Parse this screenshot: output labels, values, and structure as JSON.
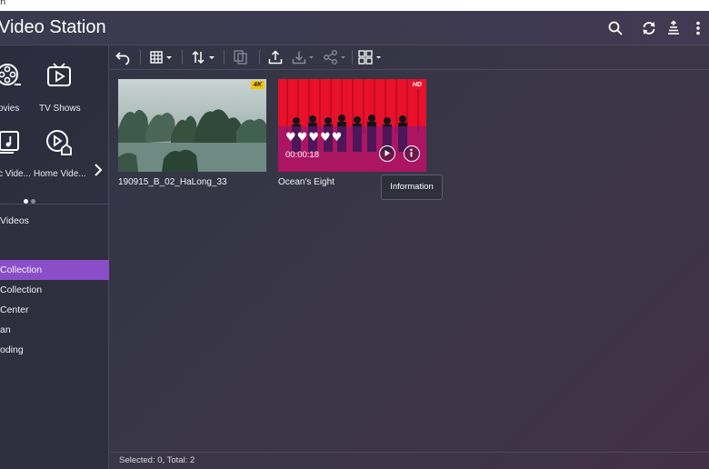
{
  "top_strip": {
    "text": "n"
  },
  "header": {
    "title": "Video Station",
    "icons": [
      "search-icon",
      "refresh-icon",
      "tasks-icon",
      "more-icon"
    ]
  },
  "sidebar": {
    "tiles": [
      {
        "label": "ovies",
        "icon": "film-reel-icon"
      },
      {
        "label": "TV Shows",
        "icon": "tv-icon"
      },
      {
        "label": "c Vide...",
        "icon": "music-video-icon"
      },
      {
        "label": "Home Vide...",
        "icon": "home-video-icon"
      }
    ],
    "section_label": "Videos",
    "nav_items": [
      {
        "label": "Collection",
        "active": true
      },
      {
        "label": "Collection",
        "active": false
      },
      {
        "label": "Center",
        "active": false
      },
      {
        "label": "an",
        "active": false
      },
      {
        "label": "oding",
        "active": false
      }
    ],
    "page_dots": 2,
    "active_page": 1
  },
  "toolbar": {
    "icons": [
      "back-icon",
      "grid-view-icon",
      "sort-icon",
      "copy-icon",
      "upload-icon",
      "download-icon",
      "share-icon",
      "multi-select-icon"
    ]
  },
  "videos": [
    {
      "title": "190915_B_02_HaLong_33",
      "badge": "4K",
      "badge_color": "#f5c400"
    },
    {
      "title": "Ocean's Eight",
      "badge": "HD",
      "badge_color": "#e8102a",
      "rating_hearts": 5,
      "duration": "00:00:18"
    }
  ],
  "tooltip": {
    "text": "Information"
  },
  "status": {
    "text": "Selected: 0, Total: 2"
  },
  "colors": {
    "accent": "#8a4fc8",
    "icon_dim": "#8a8a9a"
  }
}
